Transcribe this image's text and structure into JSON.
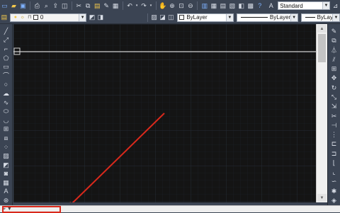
{
  "toolbar_top": {
    "layer_value": "0",
    "style_dropdown": "Standard"
  },
  "toolbar_props": {
    "color_value": "ByLayer",
    "linetype_value": "ByLayer",
    "lineweight_value": "ByLayer"
  },
  "status": {
    "text": "⌖ ▼"
  },
  "colors": {
    "canvas": "#141414",
    "grid_minor": "#1e232b",
    "grid_major": "#262c36",
    "annotation_arrow": "#d9291c",
    "toolbar_bg": "#3b4453"
  },
  "icons": {
    "left_toolbar": [
      "line-icon",
      "construction-line-icon",
      "polyline-icon",
      "polygon-icon",
      "rectangle-icon",
      "arc-icon",
      "circle-icon",
      "revcloud-icon",
      "spline-icon",
      "ellipse-icon",
      "ellipse-arc-icon",
      "insert-block-icon",
      "make-block-icon",
      "point-icon",
      "hatch-icon",
      "gradient-icon",
      "region-icon",
      "table-icon",
      "mtext-icon",
      "add-selected-icon"
    ],
    "right_toolbar": [
      "erase-icon",
      "copy-icon",
      "mirror-icon",
      "offset-icon",
      "array-icon",
      "move-icon",
      "rotate-icon",
      "scale-icon",
      "stretch-icon",
      "trim-icon",
      "extend-icon",
      "break-point-icon",
      "break-icon",
      "join-icon",
      "chamfer-icon",
      "fillet-icon",
      "blend-icon",
      "explode-icon",
      "pan-icon"
    ]
  }
}
